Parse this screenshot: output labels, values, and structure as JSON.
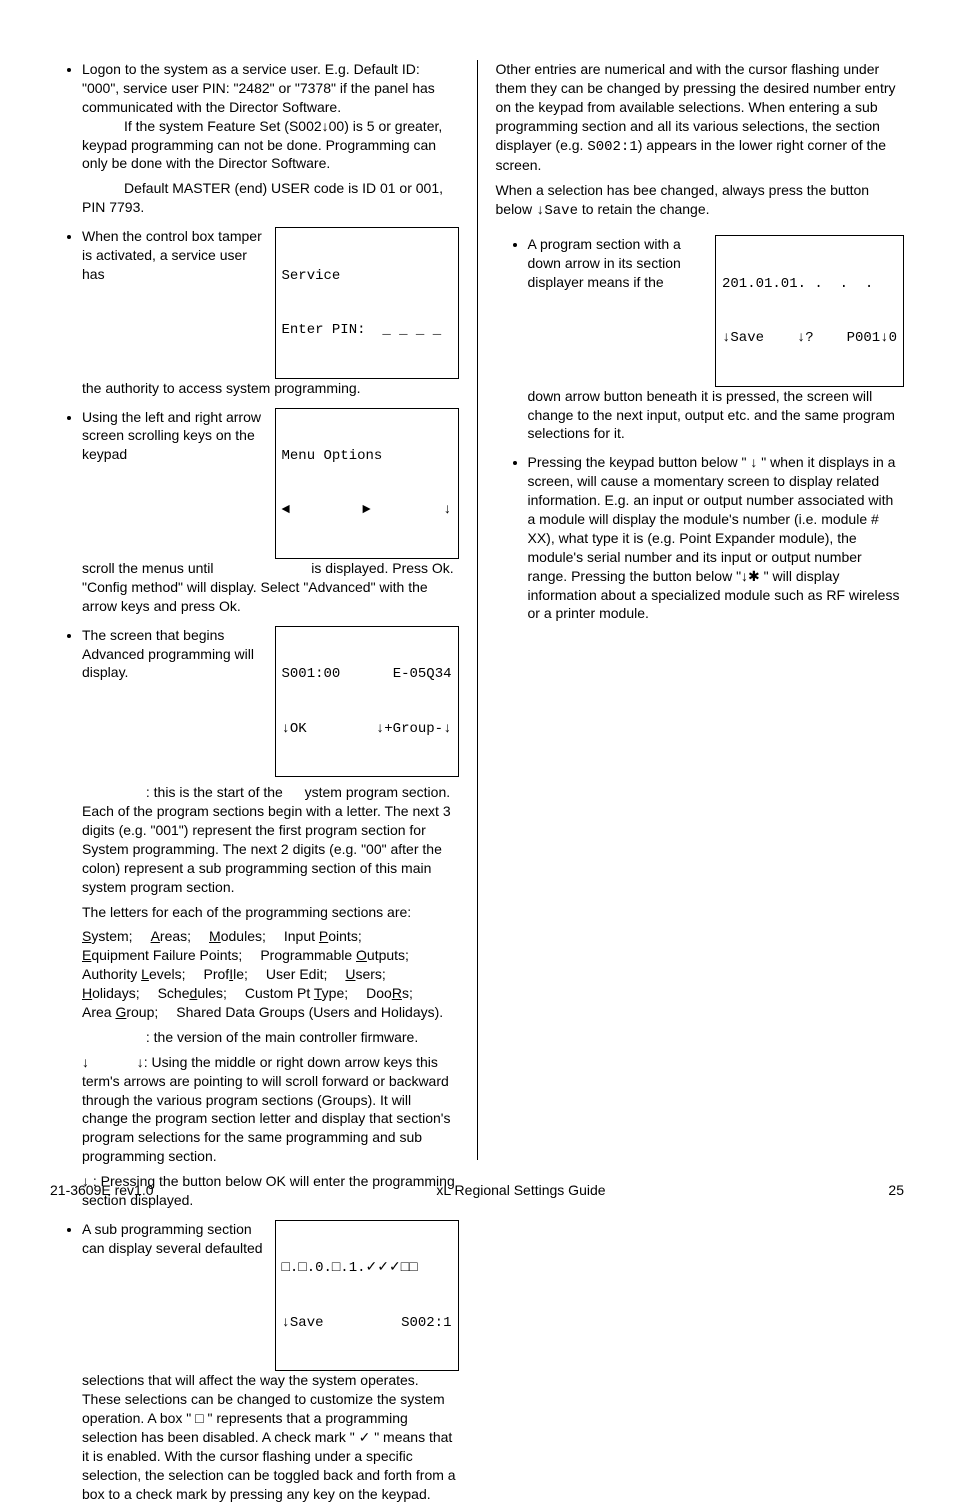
{
  "left": {
    "b1_l1": "Logon to the system as a service user. E.g. Default ID: \"000\", service user PIN: \"2482\" or \"7378\" if the panel has communicated with the Director Software.",
    "b1_l2": "If the system Feature Set (S002↓00) is 5 or greater, keypad programming can not be done. Programming can only be done with the Director Software.",
    "b1_l3": "Default MASTER (end) USER code is ID 01 or 001, PIN 7793.",
    "b2_l1": "When the control box tamper is activated, a service user has",
    "b2_l2": "the authority to access system programming.",
    "b3_l1": "Using the left and right arrow screen scrolling keys on the keypad",
    "b3_l2": "scroll the menus until",
    "b3_l3": "is displayed. Press Ok. \"Config method\" will display. Select \"Advanced\" with the arrow keys and press Ok.",
    "b4_l1": "The screen that begins Advanced programming will display.",
    "b4_l2": ": this is the start of the",
    "b4_l2b": "ystem program section. Each of the program sections begin with a letter. The next 3 digits (e.g. \"001\") represent the first program section for System programming. The next 2 digits (e.g. \"00\" after the colon) represent a sub programming section of this main system program section.",
    "b4_l3": "The letters for each of the programming sections are:",
    "sections": [
      {
        "u": "S",
        "rest": "ystem;"
      },
      {
        "u": "A",
        "rest": "reas;"
      },
      {
        "u": "M",
        "rest": "odules;"
      },
      {
        "pre": "Input ",
        "u": "P",
        "rest": "oints;"
      },
      {
        "u": "E",
        "rest": "quipment Failure Points;"
      },
      {
        "pre": "Programmable ",
        "u": "O",
        "rest": "utputs;"
      },
      {
        "pre": "Authority ",
        "u": "L",
        "rest": "evels;"
      },
      {
        "pre": "Prof",
        "u": "I",
        "rest": "le;"
      },
      {
        "pre": "User Edit;",
        "u": "",
        "rest": ""
      },
      {
        "u": "U",
        "rest": "sers;"
      },
      {
        "u": "H",
        "rest": "olidays;"
      },
      {
        "pre": "Sche",
        "u": "d",
        "rest": "ules;"
      },
      {
        "pre": "Custom Pt ",
        "u": "T",
        "rest": "ype;"
      },
      {
        "pre": "Doo",
        "u": "R",
        "rest": "s;"
      },
      {
        "pre": "Area ",
        "u": "G",
        "rest": "roup;"
      },
      {
        "pre": "Shared Data Groups (Users and Holidays).",
        "u": "",
        "rest": ""
      }
    ],
    "b4_l4": ": the version of the main controller firmware.",
    "b4_l5a": "↓",
    "b4_l5b": "↓: Using the middle or right down arrow keys this term's arrows are pointing to will scroll forward or backward through the various program sections (Groups). It will change the program section letter and display that section's program selections for the same programming and sub programming section.",
    "b4_l6": "↓   : Pressing the button below OK will enter the programming section displayed.",
    "b5_l1": "A sub programming section can display several defaulted",
    "b5_l2": "selections that will affect the way the system operates. These selections can be changed to customize the system operation. A box \" □ \" represents that a programming selection has been disabled. A check mark \" ✓ \" means that it is enabled. With the cursor flashing under a specific selection, the selection can be toggled back and forth from a box to a check mark by pressing any key on the keypad."
  },
  "right": {
    "p1": "Other entries are numerical and with the cursor flashing under them they can be changed by pressing the desired number entry on the keypad from available selections. When entering a sub programming section and all its various selections, the section displayer (e.g. ",
    "p1_code": "S002:1",
    "p1b": ") appears in the lower right corner of the screen.",
    "p2a": "When a selection has bee changed, always press the button below ",
    "p2_code": "↓Save",
    "p2b": " to retain the change.",
    "b1_l1": "A program section with a down arrow in its section displayer means if the",
    "b1_l2": "down arrow button beneath it is pressed, the screen will change to the next input, output etc. and the same program selections for it.",
    "b2_l1": "Pressing the keypad button below \" ↓   \" when it displays in a screen, will cause a momentary screen to display related information. E.g. an input or output number associated with a module will display the module's number (i.e. module # XX), what type it is (e.g. Point Expander module), the module's serial number and its input or output number range. Pressing the button below \"↓✱ \" will display information about a specialized module such as RF wireless or a printer module."
  },
  "lcd": {
    "service_l1": "Service",
    "service_l2": "Enter PIN:  _ _ _ _",
    "menu_l1": "Menu Options",
    "menu_l2_l": "◄",
    "menu_l2_m": "►",
    "menu_l2_r": "↓",
    "adv_l1_l": "S001:00",
    "adv_l1_r": "E-05Q34",
    "adv_l2_l": "↓OK",
    "adv_l2_r": "↓+Group-↓",
    "sub_l1": "□.□.0.□.1.✓✓✓□□",
    "sub_l2_l": "↓Save",
    "sub_l2_r": "S002:1",
    "prog_l1": "201.01.01. .  .  .",
    "prog_l2_l": "↓Save",
    "prog_l2_m": "↓?",
    "prog_l2_r": "P001↓0"
  },
  "footer": {
    "left": "21-3609E rev1.0",
    "center": "xL Regional Settings Guide",
    "right": "25"
  }
}
